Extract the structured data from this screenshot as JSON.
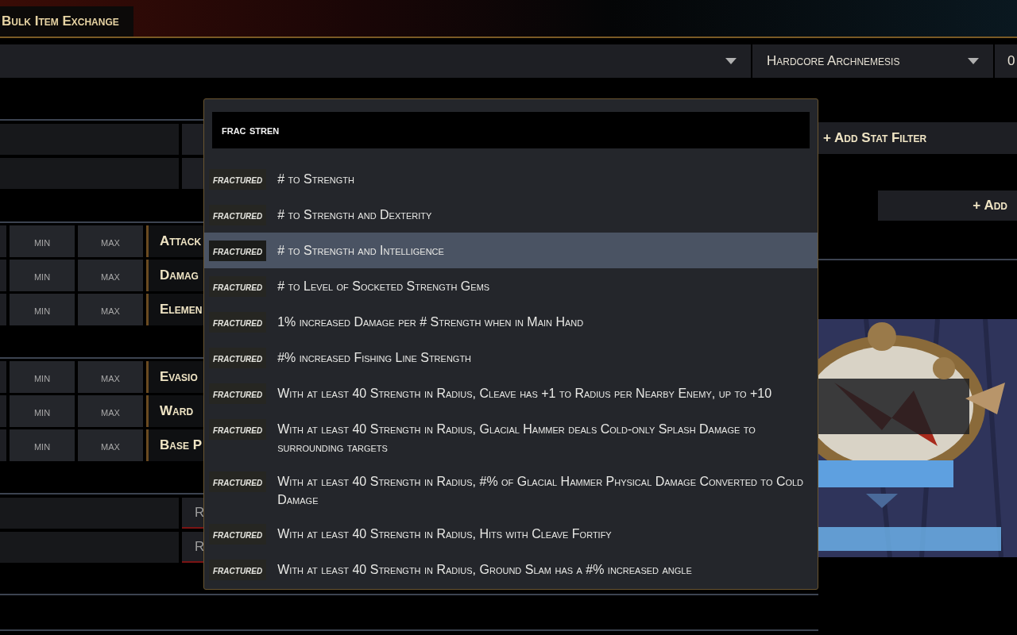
{
  "header": {
    "tab": "Bulk Item Exchange"
  },
  "top_bar": {
    "league_select": "Hardcore Archnemesis",
    "column_3": "0"
  },
  "filter_groups": [
    {
      "kind": "ranges",
      "rows": [
        {
          "min": "min",
          "max": "max",
          "label": "Attack"
        },
        {
          "min": "min",
          "max": "max",
          "label": "Damag"
        },
        {
          "min": "min",
          "max": "max",
          "label": "Elemen"
        }
      ]
    },
    {
      "kind": "ranges",
      "rows": [
        {
          "min": "min",
          "max": "max",
          "label": "Evasio"
        },
        {
          "min": "min",
          "max": "max",
          "label": "Ward"
        },
        {
          "min": "min",
          "max": "max",
          "label": "Base P"
        }
      ]
    },
    {
      "kind": "fields",
      "rows": [
        {
          "button": "R"
        },
        {
          "button": "R"
        }
      ]
    }
  ],
  "side": {
    "add_stat_filter": "+ Add Stat Filter",
    "add_button": "+ Add"
  },
  "stat_dropdown": {
    "query": "frac stren",
    "options": [
      {
        "tag": "fractured",
        "text": "# to Strength",
        "selected": false
      },
      {
        "tag": "fractured",
        "text": "# to Strength and Dexterity",
        "selected": false
      },
      {
        "tag": "fractured",
        "text": "# to Strength and Intelligence",
        "selected": true
      },
      {
        "tag": "fractured",
        "text": "# to Level of Socketed Strength Gems",
        "selected": false
      },
      {
        "tag": "fractured",
        "text": "1% increased Damage per # Strength when in Main Hand",
        "selected": false
      },
      {
        "tag": "fractured",
        "text": "#% increased Fishing Line Strength",
        "selected": false
      },
      {
        "tag": "fractured",
        "text": "With at least 40 Strength in Radius, Cleave has +1 to Radius per Nearby Enemy, up to +10",
        "selected": false
      },
      {
        "tag": "fractured",
        "text": "With at least 40 Strength in Radius, Glacial Hammer deals Cold-only Splash Damage to surrounding targets",
        "selected": false
      },
      {
        "tag": "fractured",
        "text": "With at least 40 Strength in Radius, #% of Glacial Hammer Physical Damage Converted to Cold Damage",
        "selected": false
      },
      {
        "tag": "fractured",
        "text": "With at least 40 Strength in Radius, Hits with Cleave Fortify",
        "selected": false
      },
      {
        "tag": "fractured",
        "text": "With at least 40 Strength in Radius, Ground Slam has a #% increased angle",
        "selected": false
      }
    ]
  }
}
